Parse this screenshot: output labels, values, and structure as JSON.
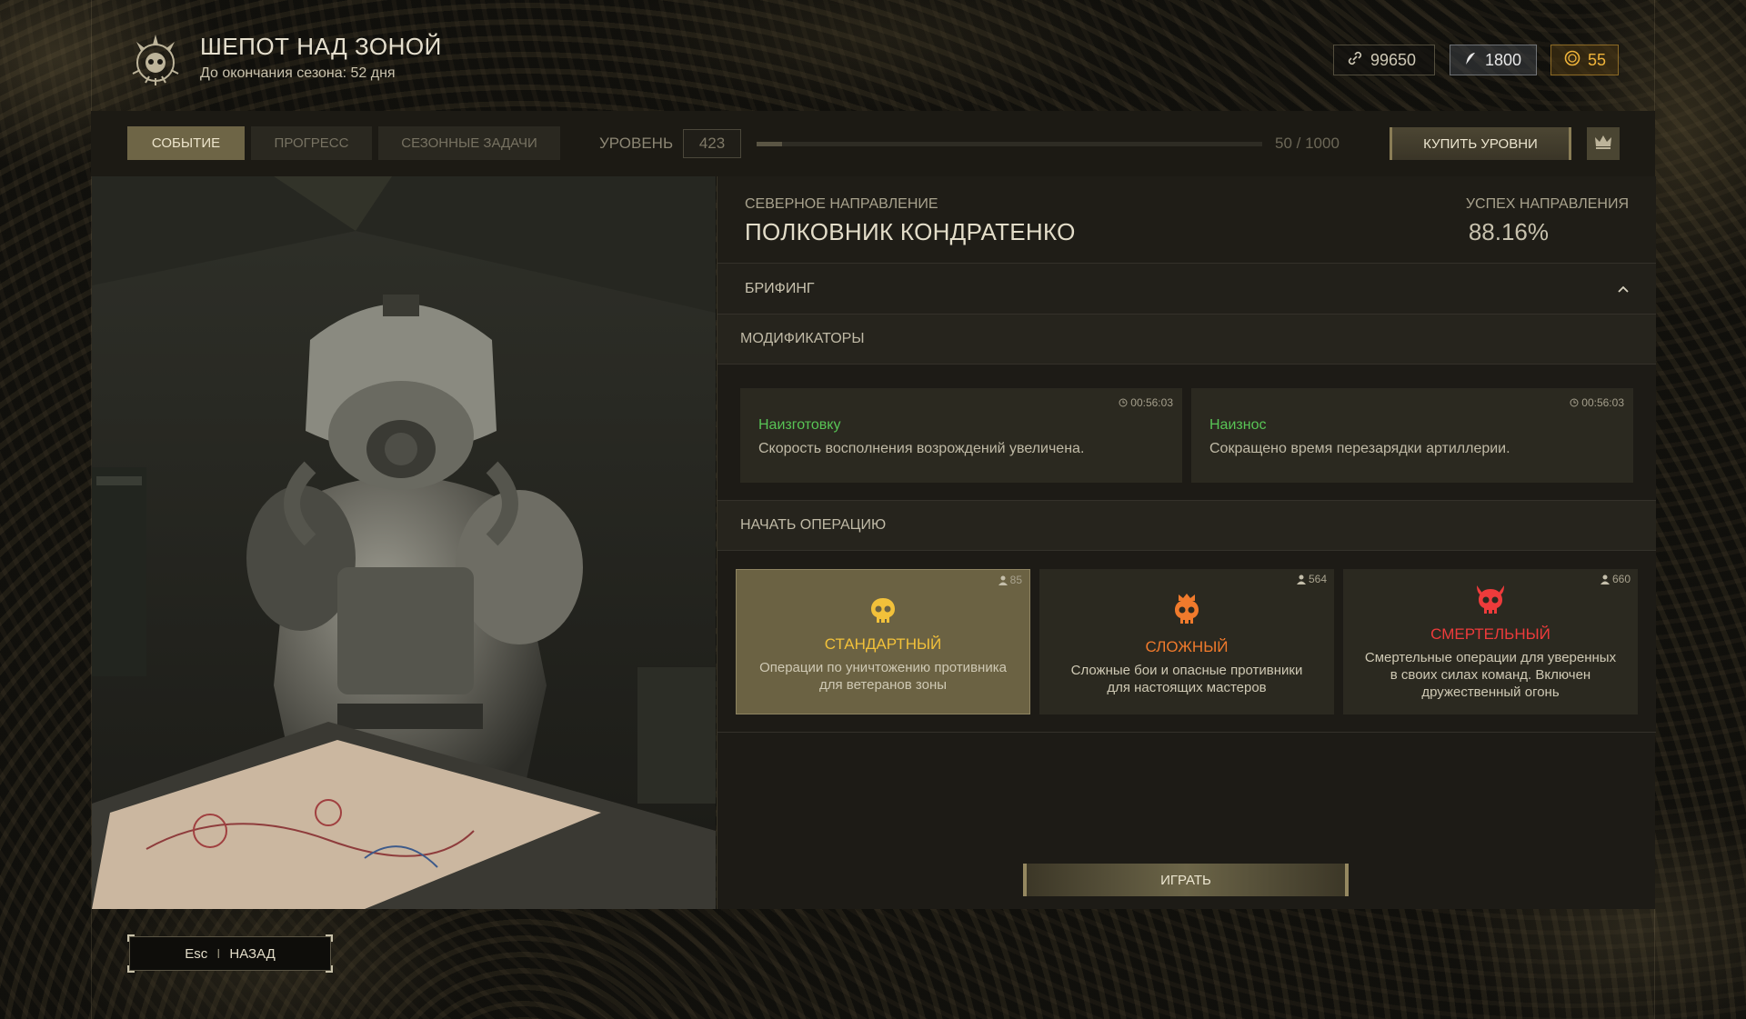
{
  "header": {
    "title": "ШЕПОТ НАД ЗОНОЙ",
    "subtitle": "До окончания сезона: 52 дня",
    "currencies": [
      {
        "icon": "link-icon",
        "value": "99650"
      },
      {
        "icon": "feather-icon",
        "value": "1800"
      },
      {
        "icon": "coin-icon",
        "value": "55"
      }
    ]
  },
  "toolbar": {
    "tabs": [
      {
        "label": "СОБЫТИЕ",
        "active": true
      },
      {
        "label": "ПРОГРЕСС",
        "active": false
      },
      {
        "label": "СЕЗОННЫЕ ЗАДАЧИ",
        "active": false
      }
    ],
    "level_label": "УРОВЕНЬ",
    "level_value": "423",
    "progress_text": "50 / 1000",
    "progress_fraction": 0.05,
    "buy_label": "КУПИТЬ УРОВНИ"
  },
  "mission": {
    "direction": "СЕВЕРНОЕ НАПРАВЛЕНИЕ",
    "commander": "ПОЛКОВНИК КОНДРАТЕНКО",
    "success_label": "УСПЕХ НАПРАВЛЕНИЯ",
    "success_value": "88.16%"
  },
  "briefing": {
    "label": "БРИФИНГ"
  },
  "modifiers": {
    "label": "МОДИФИКАТОРЫ",
    "items": [
      {
        "timer": "00:56:03",
        "name": "Наизготовку",
        "desc": "Скорость восполнения возрождений увеличена."
      },
      {
        "timer": "00:56:03",
        "name": "Наизнос",
        "desc": "Сокращено время перезарядки артиллерии."
      }
    ]
  },
  "operations": {
    "label": "НАЧАТЬ ОПЕРАЦИЮ",
    "items": [
      {
        "players": "85",
        "title": "СТАНДАРТНЫЙ",
        "color": "#f2c13a",
        "desc": "Операции по уничтожению противника для ветеранов зоны",
        "active": true
      },
      {
        "players": "564",
        "title": "СЛОЖНЫЙ",
        "color": "#f07a2c",
        "desc": "Сложные бои и опасные противники для настоящих мастеров",
        "active": false
      },
      {
        "players": "660",
        "title": "СМЕРТЕЛЬНЫЙ",
        "color": "#ee3b3b",
        "desc": "Смертельные операции для уверенных в своих силах команд. Включен дружественный огонь",
        "active": false
      }
    ],
    "play_label": "ИГРАТЬ"
  },
  "footer": {
    "key": "Esc",
    "separator": "I",
    "back_label": "НАЗАД"
  }
}
